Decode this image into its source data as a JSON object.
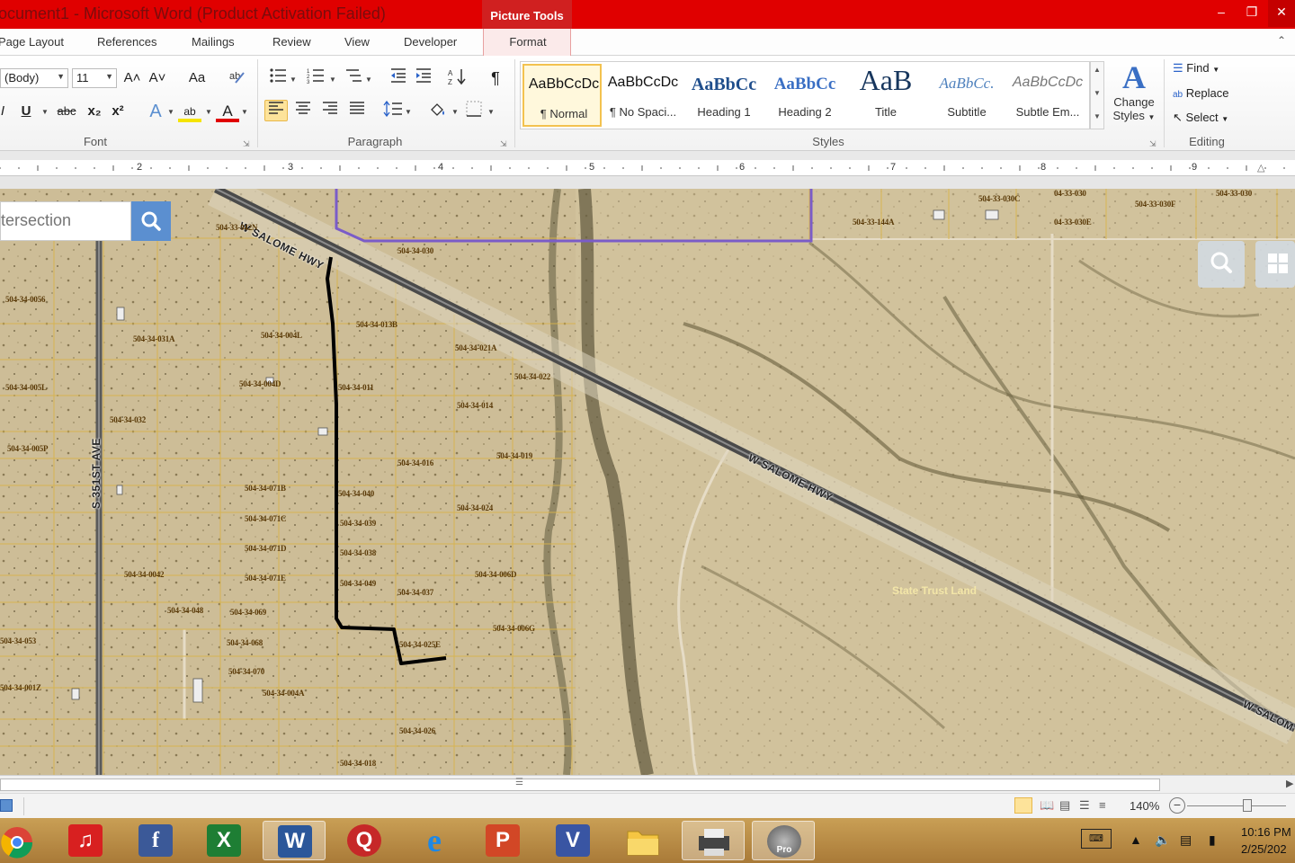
{
  "window": {
    "title": "ocument1  -  Microsoft Word (Product Activation Failed)",
    "picture_tools": "Picture Tools",
    "min": "‒",
    "max": "❐",
    "close": "✕"
  },
  "tabs": [
    {
      "label": "Page Layout"
    },
    {
      "label": "References"
    },
    {
      "label": "Mailings"
    },
    {
      "label": "Review"
    },
    {
      "label": "View"
    },
    {
      "label": "Developer"
    },
    {
      "label": "Format"
    }
  ],
  "ribbon": {
    "font": {
      "group_label": "Font",
      "font_name": "(Body)",
      "font_size": "11",
      "grow": "A˄",
      "shrink": "A˅",
      "change_case": "Aa",
      "underline": "U",
      "strike": "abc",
      "subscript": "x₂",
      "superscript": "x²",
      "highlight": "ab",
      "font_color": "A"
    },
    "paragraph": {
      "group_label": "Paragraph",
      "pilcrow": "¶"
    },
    "styles": {
      "group_label": "Styles",
      "items": [
        {
          "sample": "AaBbCcDc",
          "name": "¶ Normal"
        },
        {
          "sample": "AaBbCcDc",
          "name": "¶ No Spaci..."
        },
        {
          "sample": "AaBbCc",
          "name": "Heading 1"
        },
        {
          "sample": "AaBbCc",
          "name": "Heading 2"
        },
        {
          "sample": "AaB",
          "name": "Title"
        },
        {
          "sample": "AaBbCc.",
          "name": "Subtitle"
        },
        {
          "sample": "AaBbCcDc",
          "name": "Subtle Em..."
        }
      ],
      "change_styles_line1": "Change",
      "change_styles_line2": "Styles",
      "change_styles_glyph": "A"
    },
    "editing": {
      "group_label": "Editing",
      "find": "Find",
      "replace": "Replace",
      "select": "Select"
    }
  },
  "ruler": {
    "numbers": [
      "2",
      "3",
      "4",
      "5",
      "6",
      "7",
      "8",
      "9"
    ]
  },
  "map": {
    "search_placeholder": "tersection",
    "road_labels": {
      "salome_top": "W SALOME HWY",
      "salome_mid": "W SALOME HWY",
      "salome_right": "W SALOM",
      "ave35": "S 351ST AVE"
    },
    "state_trust": "State Trust Land",
    "parcels": [
      "504-33-042N",
      "504-34-030",
      "504-34-0056",
      "504-34-031A",
      "504-34-004L",
      "504-34-013B",
      "504-34-021A",
      "504-34-005L",
      "504-34-004D",
      "504-34-011",
      "504-34-022",
      "504-34-014",
      "504-34-032",
      "504-34-005P",
      "504-34-016",
      "504-34-019",
      "504-34-071B",
      "504-34-040",
      "504-34-071C",
      "504-34-024",
      "504-34-039",
      "504-34-071D",
      "504-34-038",
      "504-34-006D",
      "504-34-0042",
      "504-34-071E",
      "504-34-049",
      "504-34-037",
      "504-34-048",
      "504-34-069",
      "504-34-006G",
      "504-34-053",
      "504-34-068",
      "504-34-025E",
      "504-34-070",
      "504-34-001Z",
      "504-34-004A",
      "504-34-026",
      "504-34-018",
      "504-33-030C",
      "504-33-144A",
      "04-33-030E",
      "504-33-030F",
      "504-33-030",
      "04-33-030"
    ]
  },
  "status": {
    "zoom": "140%"
  },
  "taskbar": {
    "time": "10:16 PM",
    "date": "2/25/202",
    "apps": [
      {
        "name": "chrome",
        "glyph": ""
      },
      {
        "name": "music",
        "glyph": "♫"
      },
      {
        "name": "facebook",
        "glyph": "f"
      },
      {
        "name": "excel",
        "glyph": "X"
      },
      {
        "name": "word",
        "glyph": "W"
      },
      {
        "name": "quicken",
        "glyph": "Q"
      },
      {
        "name": "internet-explorer",
        "glyph": "e"
      },
      {
        "name": "powerpoint",
        "glyph": "P"
      },
      {
        "name": "visio",
        "glyph": "V"
      },
      {
        "name": "file-explorer",
        "glyph": ""
      },
      {
        "name": "scanner",
        "glyph": ""
      },
      {
        "name": "google-earth-pro",
        "glyph": "Pro"
      }
    ]
  },
  "colors": {
    "titlebar": "#e00000",
    "map_ground": "#cfbf9a",
    "parcel_line": "#d9b44a",
    "boundary": "#7a5cc8",
    "route": "#000000"
  }
}
